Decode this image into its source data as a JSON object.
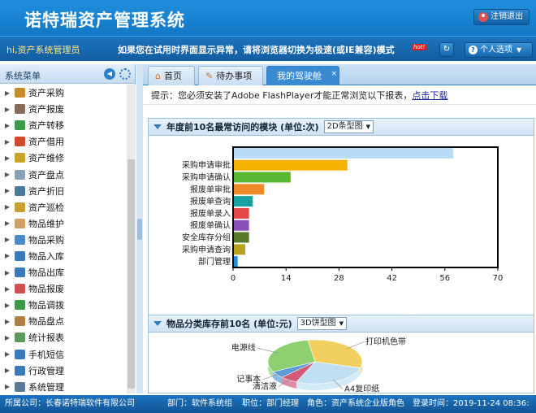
{
  "header": {
    "title": "诺特瑞资产管理系统",
    "logout_label": "注销退出"
  },
  "bar": {
    "greeting": "hi,资产系统管理员",
    "notice": "如果您在试用时界面显示异常，请将浏览器切换为极速(或IE兼容)模式",
    "badge": "hot!",
    "personal_options": "个人选项"
  },
  "sidebar": {
    "title": "系统菜单",
    "items": [
      {
        "label": "资产采购",
        "icon": "cart-icon",
        "color": "#c98a2a"
      },
      {
        "label": "资产报废",
        "icon": "trash-icon",
        "color": "#8a6b5a"
      },
      {
        "label": "资产转移",
        "icon": "transfer-icon",
        "color": "#3a9a4a"
      },
      {
        "label": "资产借用",
        "icon": "borrow-icon",
        "color": "#d04a2a"
      },
      {
        "label": "资产维修",
        "icon": "wrench-icon",
        "color": "#c9a42a"
      },
      {
        "label": "资产盘点",
        "icon": "clipboard-icon",
        "color": "#8aa0b8"
      },
      {
        "label": "资产折旧",
        "icon": "calculator-icon",
        "color": "#4a7a9a"
      },
      {
        "label": "资产巡检",
        "icon": "key-icon",
        "color": "#c9a030"
      },
      {
        "label": "物品维护",
        "icon": "box-icon",
        "color": "#d0a060"
      },
      {
        "label": "物品采购",
        "icon": "cart-icon",
        "color": "#4a8aca"
      },
      {
        "label": "物品入库",
        "icon": "inbound-icon",
        "color": "#3a7aba"
      },
      {
        "label": "物品出库",
        "icon": "outbound-icon",
        "color": "#3a7aba"
      },
      {
        "label": "物品报废",
        "icon": "trash-icon",
        "color": "#d05050"
      },
      {
        "label": "物品调拨",
        "icon": "transfer-icon",
        "color": "#3a9a4a"
      },
      {
        "label": "物品盘点",
        "icon": "inventory-icon",
        "color": "#b08040"
      },
      {
        "label": "统计报表",
        "icon": "chart-icon",
        "color": "#5a9a5a"
      },
      {
        "label": "手机短信",
        "icon": "phone-icon",
        "color": "#3a7ab8"
      },
      {
        "label": "行政管理",
        "icon": "admin-icon",
        "color": "#3a7ab8"
      },
      {
        "label": "系统管理",
        "icon": "system-icon",
        "color": "#5a7a9a"
      }
    ]
  },
  "tabs": [
    {
      "label": "首页",
      "icon": "home-icon"
    },
    {
      "label": "待办事项",
      "icon": "todo-icon"
    },
    {
      "label": "我的驾驶舱",
      "active": true,
      "close": "×"
    }
  ],
  "hint": {
    "text": "提示：您必须安装了Adobe FlashPlayer才能正常浏览以下报表，",
    "link": "点击下载"
  },
  "chart_data": [
    {
      "type": "bar",
      "orientation": "horizontal",
      "title": "年度前10名最常访问的模块 (单位:次)",
      "selector": "2D条型图",
      "categories": [
        "",
        "采购申请审批",
        "采购申请确认",
        "报废单审批",
        "报废单查询",
        "报废单录入",
        "报废单确认",
        "安全库存分组",
        "采购申请查询",
        "部门管理"
      ],
      "values": [
        58,
        30,
        15,
        8,
        5,
        4,
        4,
        4,
        3,
        1
      ],
      "colors": [
        "#b9dbf5",
        "#f5b301",
        "#58b832",
        "#ef8a2c",
        "#16a2a0",
        "#e54848",
        "#8a4fb8",
        "#5a7a2a",
        "#b8a020",
        "#1f8fdc"
      ],
      "xticks": [
        0,
        14,
        28,
        42,
        56,
        70
      ],
      "xlim": [
        0,
        70
      ]
    },
    {
      "type": "pie",
      "title": "物品分类库存前10名 (单位:元)",
      "selector": "3D饼型图",
      "slices": [
        {
          "label": "打印机色带",
          "value": 32,
          "color": "#f2d060"
        },
        {
          "label": "A4复印纸",
          "value": 27,
          "color": "#bfe0f2"
        },
        {
          "label": "清洁液",
          "value": 6,
          "color": "#d45a7a"
        },
        {
          "label": "记事本",
          "value": 5,
          "color": "#5a9ad8"
        },
        {
          "label": "电源线",
          "value": 30,
          "color": "#8ed070"
        }
      ]
    }
  ],
  "footer": {
    "company": "所属公司：长春诺特瑞软件有限公司",
    "dept": "部门：软件系统组",
    "position": "职位：部门经理",
    "role": "角色：资产系统企业版角色",
    "login": "登录时间：2019-11-24 08:36:"
  }
}
